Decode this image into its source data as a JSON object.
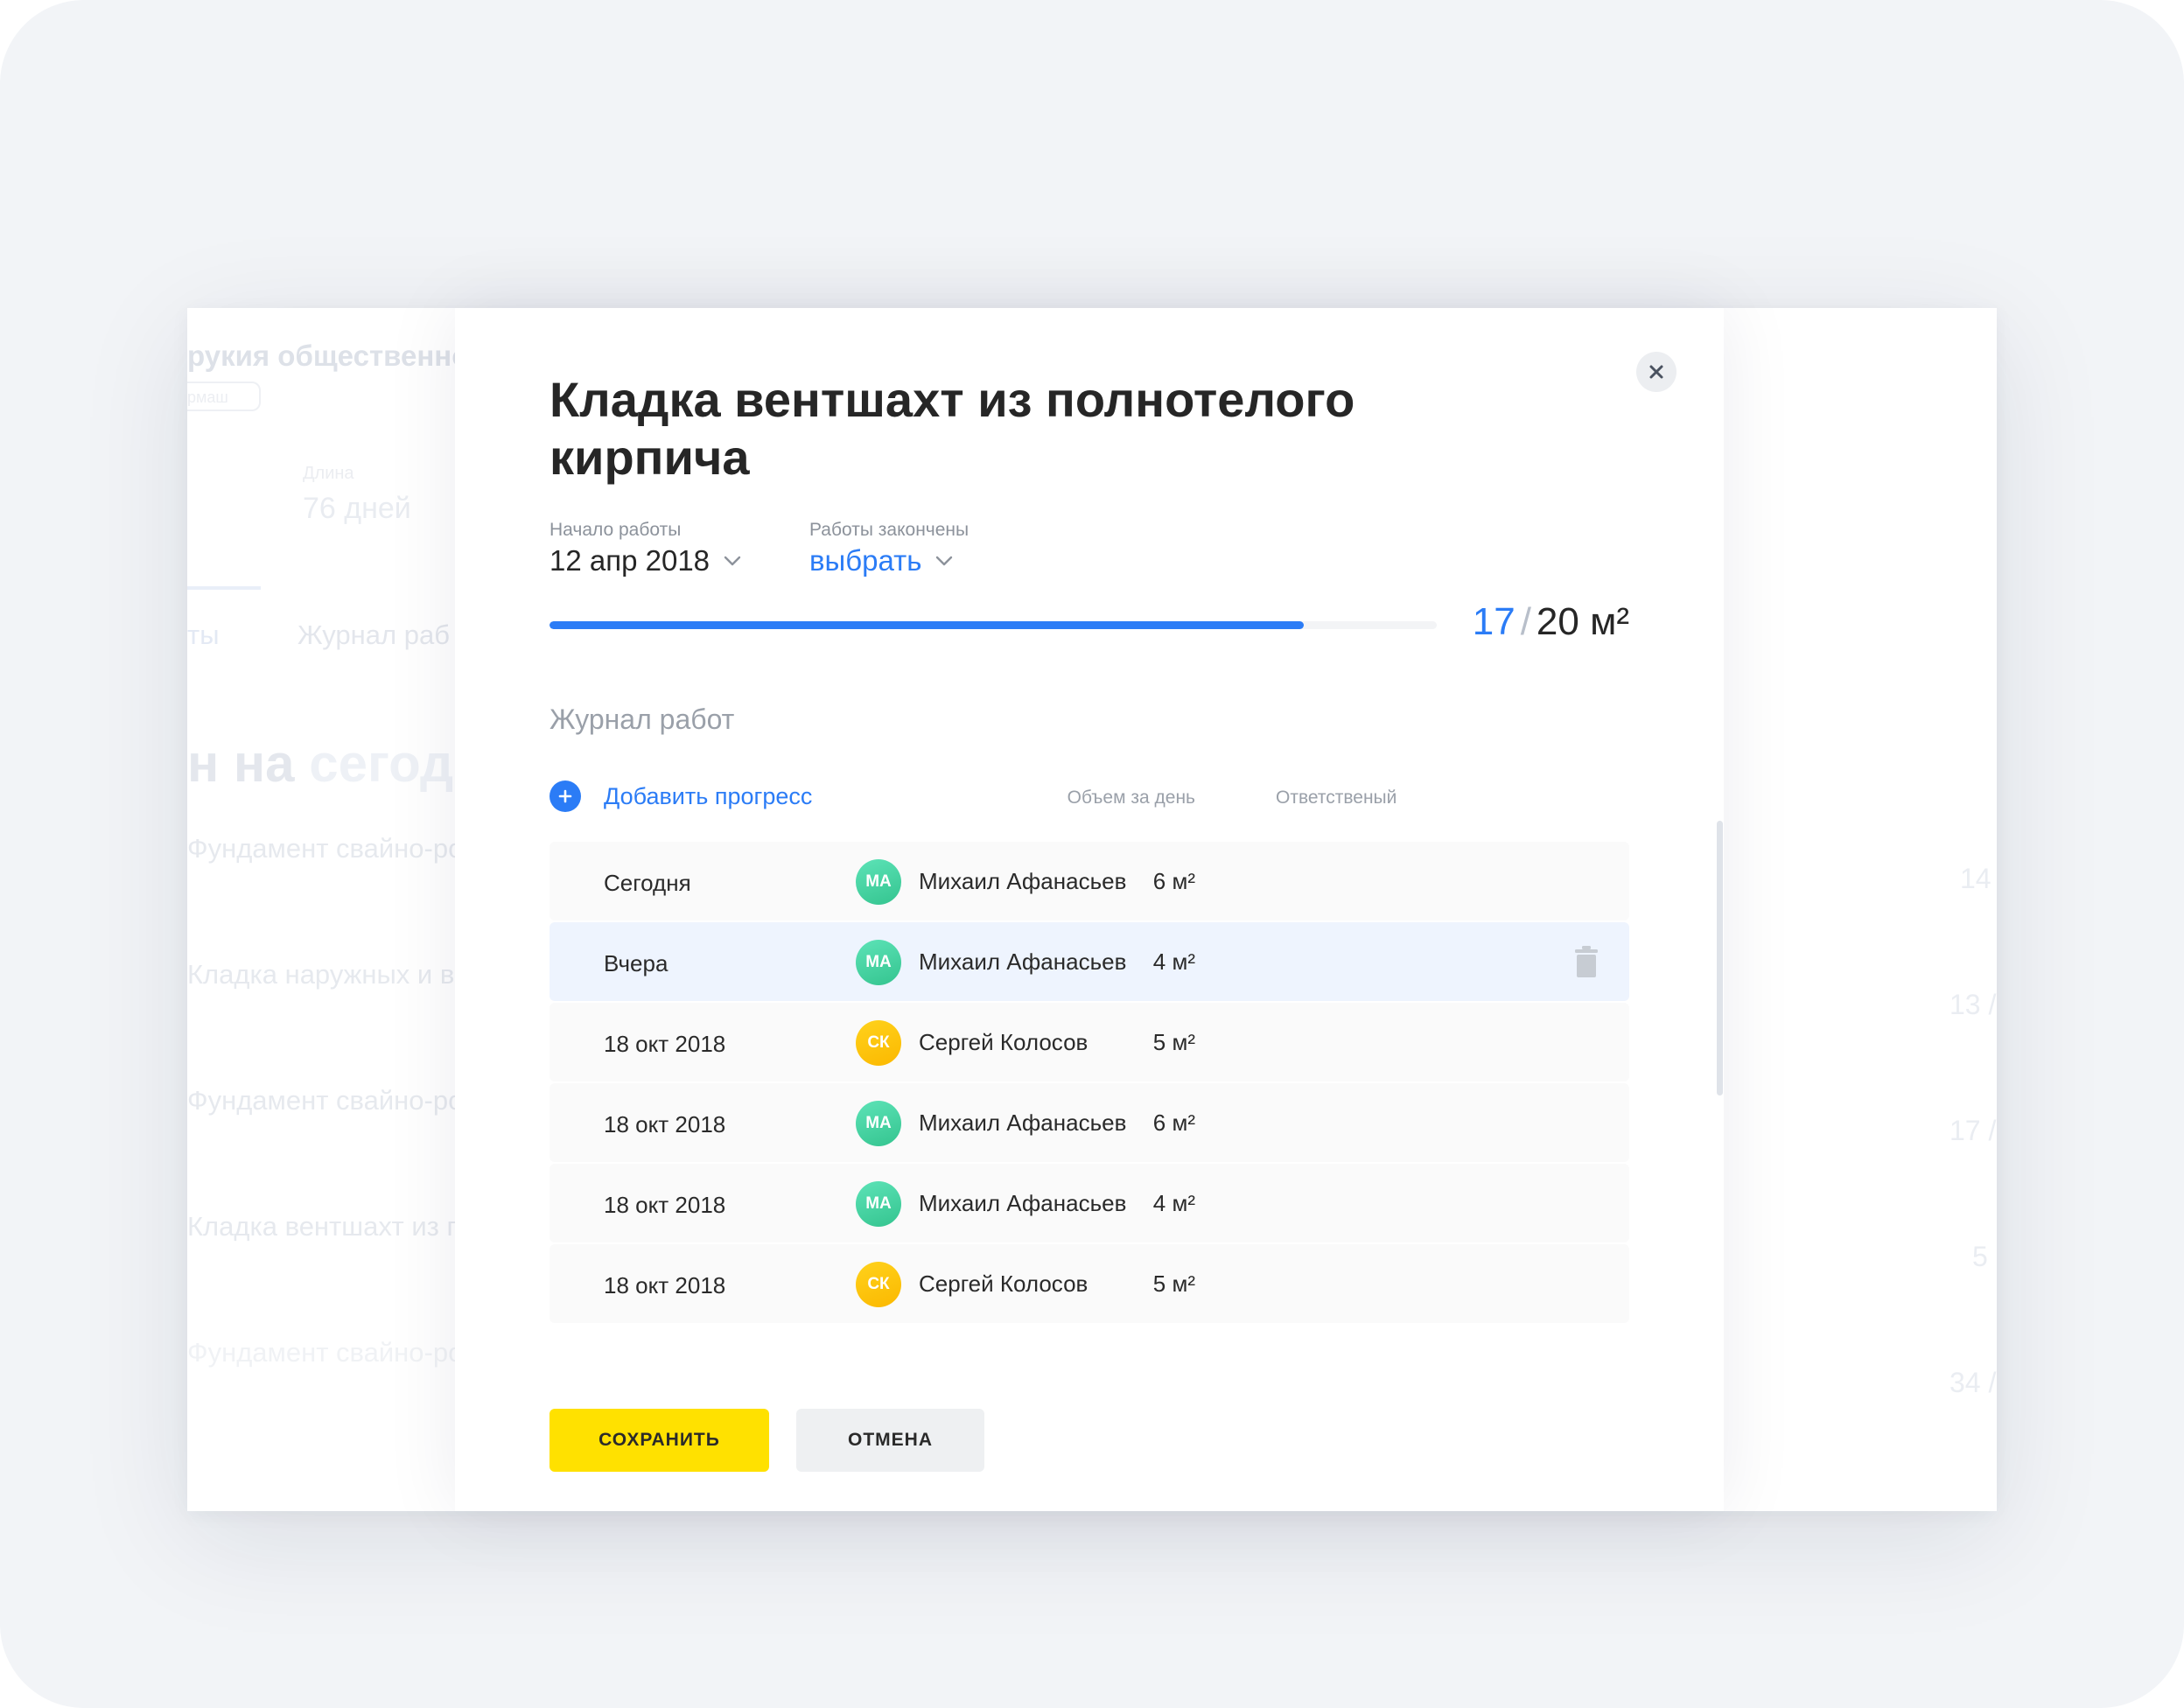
{
  "background": {
    "project_title": "рукия общественной",
    "tag_text": "рмаш",
    "stat_label": "Длина",
    "stat_value": "76 дней",
    "tabs": [
      "ты",
      "Журнал раб"
    ],
    "heading_part1": "н на ",
    "heading_part2": "сегод",
    "rows": [
      "Фундамент свайно-ро",
      "Кладка наружных и в",
      "Фундамент свайно-ро",
      "Кладка вентшахт из п",
      "Фундамент свайно-ро"
    ],
    "right_numbers": [
      "14",
      "13 /",
      "17 /",
      "5",
      "34 /"
    ]
  },
  "modal": {
    "title": "Кладка вентшахт из полнотелого кирпича",
    "start": {
      "label": "Начало работы",
      "value": "12 апр 2018"
    },
    "finish": {
      "label": "Работы закончены",
      "value": "выбрать"
    },
    "progress": {
      "done": "17",
      "separator": "/",
      "total": "20 м²",
      "fraction": 0.85,
      "color": "#2b7cf6"
    },
    "journal": {
      "heading": "Журнал работ",
      "add_label": "Добавить прогресс",
      "col_volume": "Объем за день",
      "col_responsible": "Ответственый",
      "rows": [
        {
          "date": "Сегодня",
          "volume": "6 м²",
          "initials": "МА",
          "person": "Михаил Афанасьев",
          "avatar": "green"
        },
        {
          "date": "Вчера",
          "volume": "4 м²",
          "initials": "МА",
          "person": "Михаил Афанасьев",
          "avatar": "green",
          "selected": true
        },
        {
          "date": "18 окт 2018",
          "volume": "5 м²",
          "initials": "СК",
          "person": "Сергей Колосов",
          "avatar": "yellow"
        },
        {
          "date": "18 окт 2018",
          "volume": "6 м²",
          "initials": "МА",
          "person": "Михаил Афанасьев",
          "avatar": "green"
        },
        {
          "date": "18 окт 2018",
          "volume": "4 м²",
          "initials": "МА",
          "person": "Михаил Афанасьев",
          "avatar": "green"
        },
        {
          "date": "18 окт 2018",
          "volume": "5 м²",
          "initials": "СК",
          "person": "Сергей Колосов",
          "avatar": "yellow"
        }
      ]
    },
    "buttons": {
      "save": "СОХРАНИТЬ",
      "cancel": "ОТМЕНА"
    }
  },
  "icons": {
    "close": "close-icon",
    "chevron": "chevron-down-icon",
    "add": "plus-circle-icon",
    "delete": "trash-icon"
  },
  "colors": {
    "accent": "#2b7cf6",
    "save_button": "#ffe100",
    "avatar_green": "#3fd19c",
    "avatar_yellow": "#fcc400"
  }
}
